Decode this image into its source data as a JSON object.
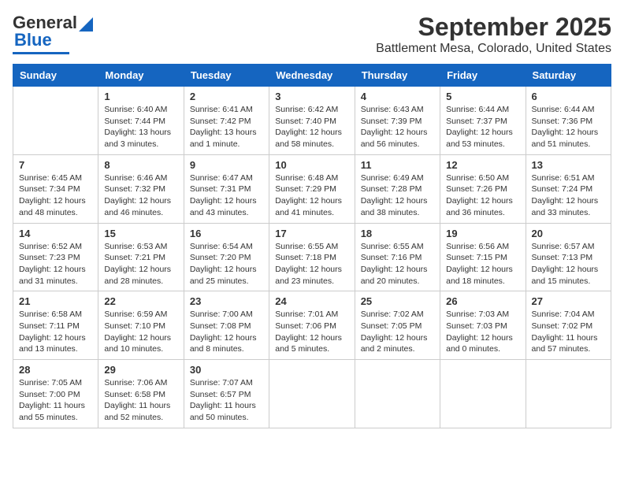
{
  "logo": {
    "text_general": "General",
    "text_blue": "Blue"
  },
  "title": "September 2025",
  "subtitle": "Battlement Mesa, Colorado, United States",
  "weekdays": [
    "Sunday",
    "Monday",
    "Tuesday",
    "Wednesday",
    "Thursday",
    "Friday",
    "Saturday"
  ],
  "weeks": [
    [
      {
        "day": "",
        "info": ""
      },
      {
        "day": "1",
        "info": "Sunrise: 6:40 AM\nSunset: 7:44 PM\nDaylight: 13 hours\nand 3 minutes."
      },
      {
        "day": "2",
        "info": "Sunrise: 6:41 AM\nSunset: 7:42 PM\nDaylight: 13 hours\nand 1 minute."
      },
      {
        "day": "3",
        "info": "Sunrise: 6:42 AM\nSunset: 7:40 PM\nDaylight: 12 hours\nand 58 minutes."
      },
      {
        "day": "4",
        "info": "Sunrise: 6:43 AM\nSunset: 7:39 PM\nDaylight: 12 hours\nand 56 minutes."
      },
      {
        "day": "5",
        "info": "Sunrise: 6:44 AM\nSunset: 7:37 PM\nDaylight: 12 hours\nand 53 minutes."
      },
      {
        "day": "6",
        "info": "Sunrise: 6:44 AM\nSunset: 7:36 PM\nDaylight: 12 hours\nand 51 minutes."
      }
    ],
    [
      {
        "day": "7",
        "info": "Sunrise: 6:45 AM\nSunset: 7:34 PM\nDaylight: 12 hours\nand 48 minutes."
      },
      {
        "day": "8",
        "info": "Sunrise: 6:46 AM\nSunset: 7:32 PM\nDaylight: 12 hours\nand 46 minutes."
      },
      {
        "day": "9",
        "info": "Sunrise: 6:47 AM\nSunset: 7:31 PM\nDaylight: 12 hours\nand 43 minutes."
      },
      {
        "day": "10",
        "info": "Sunrise: 6:48 AM\nSunset: 7:29 PM\nDaylight: 12 hours\nand 41 minutes."
      },
      {
        "day": "11",
        "info": "Sunrise: 6:49 AM\nSunset: 7:28 PM\nDaylight: 12 hours\nand 38 minutes."
      },
      {
        "day": "12",
        "info": "Sunrise: 6:50 AM\nSunset: 7:26 PM\nDaylight: 12 hours\nand 36 minutes."
      },
      {
        "day": "13",
        "info": "Sunrise: 6:51 AM\nSunset: 7:24 PM\nDaylight: 12 hours\nand 33 minutes."
      }
    ],
    [
      {
        "day": "14",
        "info": "Sunrise: 6:52 AM\nSunset: 7:23 PM\nDaylight: 12 hours\nand 31 minutes."
      },
      {
        "day": "15",
        "info": "Sunrise: 6:53 AM\nSunset: 7:21 PM\nDaylight: 12 hours\nand 28 minutes."
      },
      {
        "day": "16",
        "info": "Sunrise: 6:54 AM\nSunset: 7:20 PM\nDaylight: 12 hours\nand 25 minutes."
      },
      {
        "day": "17",
        "info": "Sunrise: 6:55 AM\nSunset: 7:18 PM\nDaylight: 12 hours\nand 23 minutes."
      },
      {
        "day": "18",
        "info": "Sunrise: 6:55 AM\nSunset: 7:16 PM\nDaylight: 12 hours\nand 20 minutes."
      },
      {
        "day": "19",
        "info": "Sunrise: 6:56 AM\nSunset: 7:15 PM\nDaylight: 12 hours\nand 18 minutes."
      },
      {
        "day": "20",
        "info": "Sunrise: 6:57 AM\nSunset: 7:13 PM\nDaylight: 12 hours\nand 15 minutes."
      }
    ],
    [
      {
        "day": "21",
        "info": "Sunrise: 6:58 AM\nSunset: 7:11 PM\nDaylight: 12 hours\nand 13 minutes."
      },
      {
        "day": "22",
        "info": "Sunrise: 6:59 AM\nSunset: 7:10 PM\nDaylight: 12 hours\nand 10 minutes."
      },
      {
        "day": "23",
        "info": "Sunrise: 7:00 AM\nSunset: 7:08 PM\nDaylight: 12 hours\nand 8 minutes."
      },
      {
        "day": "24",
        "info": "Sunrise: 7:01 AM\nSunset: 7:06 PM\nDaylight: 12 hours\nand 5 minutes."
      },
      {
        "day": "25",
        "info": "Sunrise: 7:02 AM\nSunset: 7:05 PM\nDaylight: 12 hours\nand 2 minutes."
      },
      {
        "day": "26",
        "info": "Sunrise: 7:03 AM\nSunset: 7:03 PM\nDaylight: 12 hours\nand 0 minutes."
      },
      {
        "day": "27",
        "info": "Sunrise: 7:04 AM\nSunset: 7:02 PM\nDaylight: 11 hours\nand 57 minutes."
      }
    ],
    [
      {
        "day": "28",
        "info": "Sunrise: 7:05 AM\nSunset: 7:00 PM\nDaylight: 11 hours\nand 55 minutes."
      },
      {
        "day": "29",
        "info": "Sunrise: 7:06 AM\nSunset: 6:58 PM\nDaylight: 11 hours\nand 52 minutes."
      },
      {
        "day": "30",
        "info": "Sunrise: 7:07 AM\nSunset: 6:57 PM\nDaylight: 11 hours\nand 50 minutes."
      },
      {
        "day": "",
        "info": ""
      },
      {
        "day": "",
        "info": ""
      },
      {
        "day": "",
        "info": ""
      },
      {
        "day": "",
        "info": ""
      }
    ]
  ]
}
